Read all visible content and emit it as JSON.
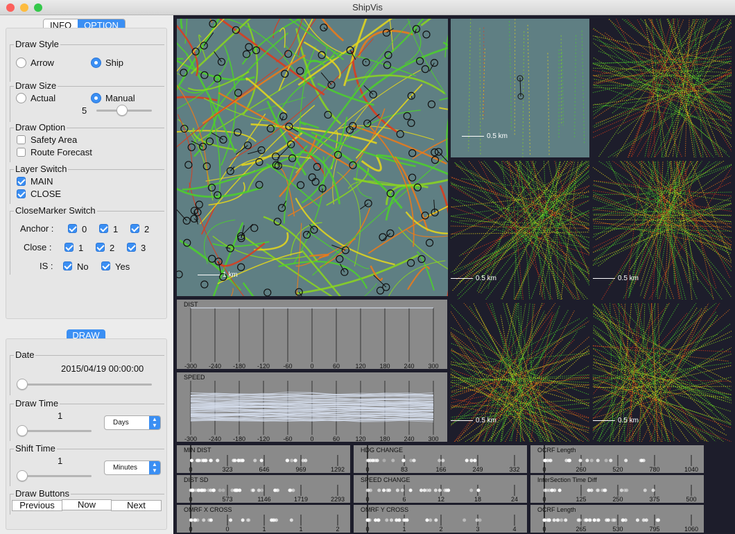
{
  "window": {
    "title": "ShipVis"
  },
  "tabs": [
    "INFO",
    "OPTION"
  ],
  "draw_style": {
    "legend": "Draw Style",
    "options": [
      "Arrow",
      "Ship"
    ],
    "selected": "Ship"
  },
  "draw_size": {
    "legend": "Draw Size",
    "options": [
      "Actual",
      "Manual"
    ],
    "selected": "Manual",
    "value": "5",
    "slider_fraction": 0.45
  },
  "draw_option": {
    "legend": "Draw Option",
    "items": [
      {
        "label": "Safety Area",
        "checked": false
      },
      {
        "label": "Route Forecast",
        "checked": false
      }
    ]
  },
  "layer_switch": {
    "legend": "Layer Switch",
    "items": [
      {
        "label": "MAIN",
        "checked": true
      },
      {
        "label": "CLOSE",
        "checked": true
      }
    ]
  },
  "close_marker": {
    "legend": "CloseMarker Switch",
    "rows": [
      {
        "label": "Anchor :",
        "items": [
          "0",
          "1",
          "2"
        ]
      },
      {
        "label": "Close :",
        "items": [
          "1",
          "2",
          "3"
        ]
      },
      {
        "label": "IS :",
        "items": [
          "No",
          "Yes"
        ]
      }
    ]
  },
  "draw_button": "DRAW",
  "date": {
    "legend": "Date",
    "value": "2015/04/19 00:00:00",
    "slider_fraction": 0.0
  },
  "draw_time": {
    "legend": "Draw Time",
    "value": "1",
    "unit": "Days",
    "slider_fraction": 0.0
  },
  "shift_time": {
    "legend": "Shift Time",
    "value": "1",
    "unit": "Minutes",
    "slider_fraction": 0.0
  },
  "draw_buttons": {
    "legend": "Draw Buttons",
    "buttons": [
      "Previous",
      "Now",
      "Next"
    ]
  },
  "map_scales": {
    "main": "1 km",
    "small": "0.5 km"
  },
  "colors": {
    "map_bg": "#5f7f83",
    "dark_bg": "#1d1d2b",
    "accent": "#3b8ff3",
    "track_green": "#4cd12a",
    "track_red": "#e03a1a",
    "track_yellow": "#e6d81c",
    "line_white": "#dde6f5"
  },
  "parallel_plots": [
    {
      "label": "DIST",
      "ticks": [
        "-300",
        "-240",
        "-180",
        "-120",
        "-60",
        "0",
        "60",
        "120",
        "180",
        "240",
        "300"
      ]
    },
    {
      "label": "SPEED",
      "ticks": [
        "-300",
        "-240",
        "-180",
        "-120",
        "-60",
        "0",
        "60",
        "120",
        "180",
        "240",
        "300"
      ]
    }
  ],
  "histograms": [
    {
      "label": "MIN DIST",
      "ticks": [
        "0",
        "323",
        "646",
        "969",
        "1292"
      ]
    },
    {
      "label": "HDG CHANGE",
      "ticks": [
        "0",
        "83",
        "166",
        "249",
        "332"
      ]
    },
    {
      "label": "OCRF Length",
      "ticks": [
        "0",
        "260",
        "520",
        "780",
        "1040"
      ]
    },
    {
      "label": "DIST SD",
      "ticks": [
        "0",
        "573",
        "1146",
        "1719",
        "2293"
      ]
    },
    {
      "label": "SPEED CHANGE",
      "ticks": [
        "0",
        "6",
        "12",
        "18",
        "24"
      ]
    },
    {
      "label": "InterSection Time Diff",
      "ticks": [
        "0",
        "125",
        "250",
        "375",
        "500"
      ]
    },
    {
      "label": "OMRF X CROSS",
      "ticks": [
        "0",
        "0",
        "1",
        "1",
        "2"
      ]
    },
    {
      "label": "OMRF Y CROSS",
      "ticks": [
        "0",
        "1",
        "2",
        "3",
        "4"
      ]
    },
    {
      "label": "OCRF Length",
      "ticks": [
        "0",
        "265",
        "530",
        "795",
        "1060"
      ]
    }
  ]
}
